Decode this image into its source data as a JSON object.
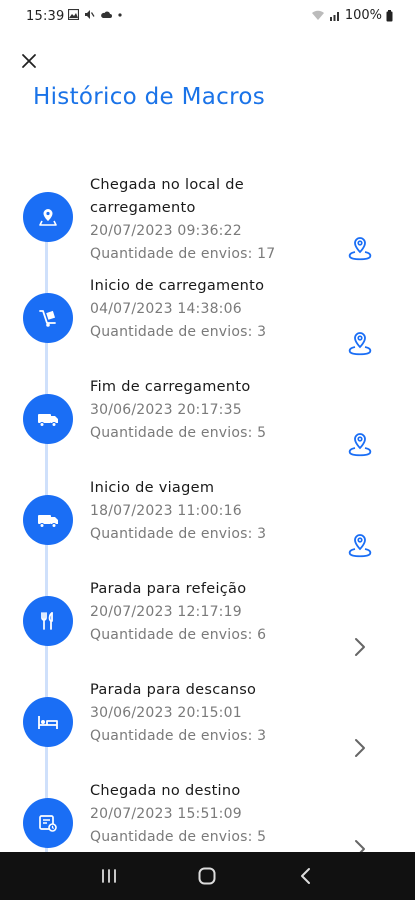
{
  "status_bar": {
    "time": "15:39",
    "battery": "100%"
  },
  "header": {
    "title": "Histórico de Macros"
  },
  "colors": {
    "accent": "#1a6ef5",
    "title": "#1a73e8",
    "timeline": "#cfe0fb"
  },
  "items": [
    {
      "name": "Chegada no local de carregamento",
      "date": "20/07/2023 09:36:22",
      "count": "Quantidade de envios: 17",
      "icon": "location-pin-icon",
      "action": "map-location-icon"
    },
    {
      "name": "Inicio de carregamento",
      "date": "04/07/2023 14:38:06",
      "count": "Quantidade de envios: 3",
      "icon": "hand-truck-icon",
      "action": "map-location-icon"
    },
    {
      "name": "Fim de carregamento",
      "date": "30/06/2023 20:17:35",
      "count": "Quantidade de envios: 5",
      "icon": "truck-icon",
      "action": "map-location-icon"
    },
    {
      "name": "Inicio de viagem",
      "date": "18/07/2023 11:00:16",
      "count": "Quantidade de envios: 3",
      "icon": "truck-icon",
      "action": "map-location-icon"
    },
    {
      "name": "Parada para refeição",
      "date": "20/07/2023 12:17:19",
      "count": "Quantidade de envios: 6",
      "icon": "fork-knife-icon",
      "action": "chevron-right-icon"
    },
    {
      "name": "Parada para descanso",
      "date": "30/06/2023 20:15:01",
      "count": "Quantidade de envios: 3",
      "icon": "bed-icon",
      "action": "chevron-right-icon"
    },
    {
      "name": "Chegada no destino",
      "date": "20/07/2023 15:51:09",
      "count": "Quantidade de envios: 5",
      "icon": "delivery-icon",
      "action": "chevron-right-icon"
    }
  ]
}
